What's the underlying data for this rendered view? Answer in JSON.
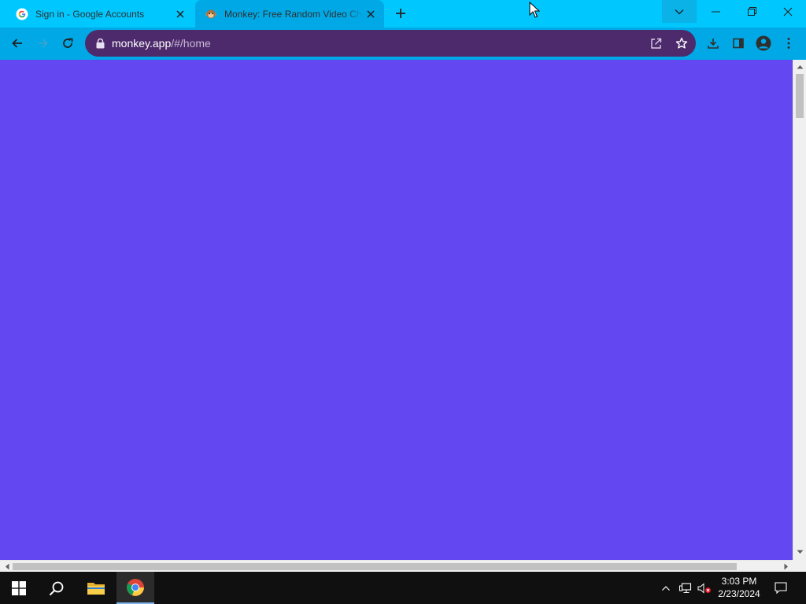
{
  "colors": {
    "tabstrip": "#00c8ff",
    "active_tab": "#00a9e6",
    "toolbar": "#00a9e6",
    "omnibox": "#4d2a6b",
    "page_background": "#6347f0",
    "taskbar": "#101010"
  },
  "tabs": [
    {
      "title": "Sign in - Google Accounts",
      "icon": "google-g-icon",
      "active": false
    },
    {
      "title": "Monkey: Free Random Video Chat",
      "icon": "monkey-favicon-icon",
      "active": true
    }
  ],
  "address_bar": {
    "host": "monkey.app",
    "path": "/#/home"
  },
  "taskbar": {
    "time": "3:03 PM",
    "date": "2/23/2024"
  }
}
